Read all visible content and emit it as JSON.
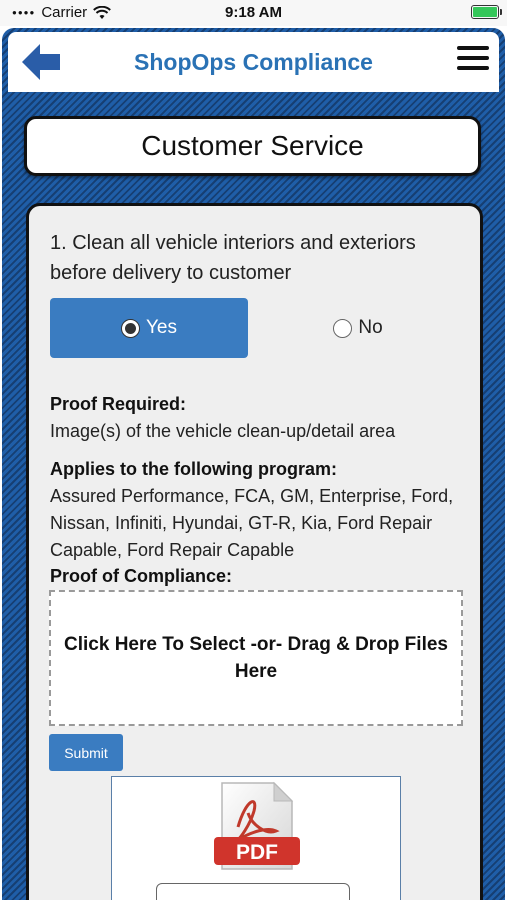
{
  "status_bar": {
    "carrier": "Carrier",
    "time": "9:18 AM"
  },
  "header": {
    "title": "ShopOps Compliance",
    "back_icon": "back-arrow-icon",
    "menu_icon": "hamburger-menu-icon"
  },
  "section": {
    "title": "Customer Service"
  },
  "question": {
    "text": "1. Clean all vehicle interiors and exteriors before delivery to customer",
    "yes_label": "Yes",
    "no_label": "No",
    "selected": "Yes"
  },
  "proof": {
    "required_label": "Proof Required:",
    "required_text": "Image(s) of the vehicle clean-up/detail area",
    "applies_label": "Applies to the following program:",
    "applies_text": "Assured Performance, FCA, GM, Enterprise, Ford, Nissan, Infiniti, Hyundai, GT-R, Kia, Ford Repair Capable, Ford Repair Capable",
    "compliance_label": "Proof of Compliance:",
    "drop_zone_text": "Click Here To Select -or- Drag & Drop Files Here",
    "submit_label": "Submit",
    "file_badge": "PDF"
  },
  "colors": {
    "accent": "#3a7cc1",
    "title_blue": "#2a72b5",
    "frame_blue": "#1f5ea8"
  }
}
